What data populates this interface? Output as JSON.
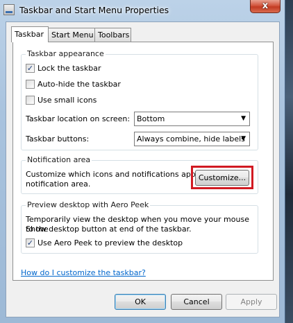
{
  "window": {
    "title": "Taskbar and Start Menu Properties",
    "close_label": "x"
  },
  "tabs": [
    {
      "label": "Taskbar",
      "active": true
    },
    {
      "label": "Start Menu",
      "active": false
    },
    {
      "label": "Toolbars",
      "active": false
    }
  ],
  "appearance": {
    "title": "Taskbar appearance",
    "lock": {
      "label": "Lock the taskbar",
      "checked": true
    },
    "autohide": {
      "label": "Auto-hide the taskbar",
      "checked": false
    },
    "small_icons": {
      "label": "Use small icons",
      "checked": false
    },
    "location": {
      "label": "Taskbar location on screen:",
      "value": "Bottom"
    },
    "buttons": {
      "label": "Taskbar buttons:",
      "value": "Always combine, hide labels"
    }
  },
  "notification": {
    "title": "Notification area",
    "description_line1": "Customize which icons and notifications appear in the",
    "description_line2": "notification area.",
    "customize_label": "Customize..."
  },
  "aero_peek": {
    "title": "Preview desktop with Aero Peek",
    "description_line1": "Temporarily view the desktop when you move your mouse to the",
    "description_line2": "Show desktop button at end of the taskbar.",
    "use": {
      "label": "Use Aero Peek to preview the desktop",
      "checked": true
    }
  },
  "help_link": "How do I customize the taskbar?",
  "footer": {
    "ok": "OK",
    "cancel": "Cancel",
    "apply": "Apply"
  },
  "icons": {
    "check_mark": "✓",
    "dropdown_arrow": "▼"
  },
  "colors": {
    "highlight": "#d11a22",
    "link": "#0066cc"
  }
}
